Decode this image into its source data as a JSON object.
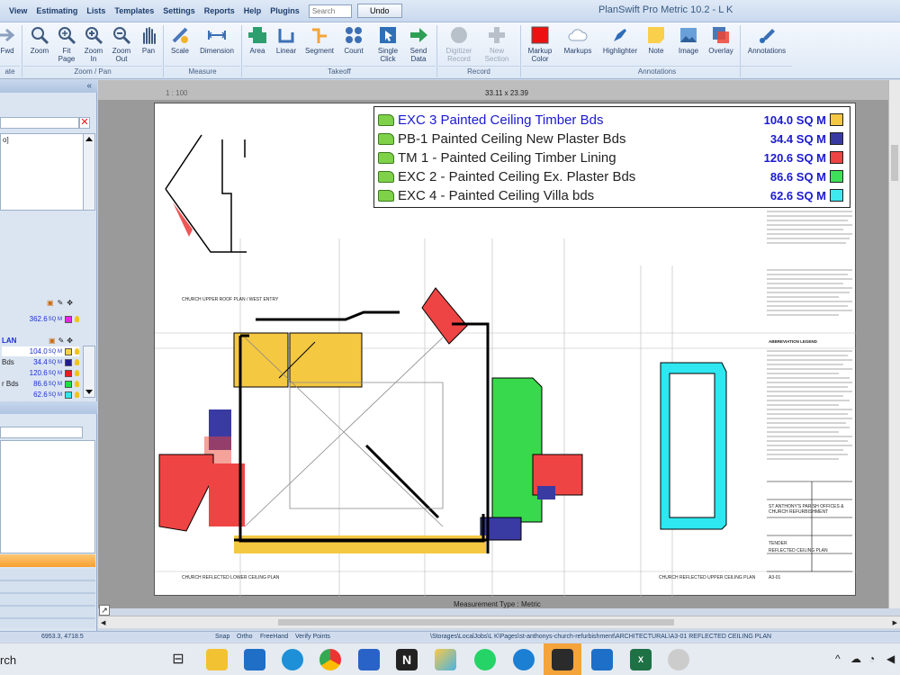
{
  "app": {
    "title": "PlanSwift Pro Metric 10.2 - L K"
  },
  "menu": [
    "View",
    "Estimating",
    "Lists",
    "Templates",
    "Settings",
    "Reports",
    "Help",
    "Plugins"
  ],
  "search_placeholder": "Search",
  "undo_label": "Undo",
  "ribbon": {
    "buttons": {
      "fwd": "Fwd",
      "zoom": "Zoom",
      "fit_page": "Fit Page",
      "zoom_in": "Zoom In",
      "zoom_out": "Zoom Out",
      "pan": "Pan",
      "scale": "Scale",
      "dimension": "Dimension",
      "area": "Area",
      "linear": "Linear",
      "segment": "Segment",
      "count": "Count",
      "single_click": "Single Click",
      "send_data": "Send Data",
      "digitizer_record": "Digitizer Record",
      "new_section": "New Section",
      "markup_color": "Markup Color",
      "markups": "Markups",
      "highlighter": "Highlighter",
      "note": "Note",
      "image": "Image",
      "overlay": "Overlay",
      "annotations": "Annotations"
    },
    "groups": {
      "ate": "ate",
      "zoom_pan": "Zoom / Pan",
      "measure": "Measure",
      "takeoff": "Takeoff",
      "record": "Record",
      "annotations": "Annotations"
    }
  },
  "left_panel": {
    "collapse": "«",
    "tree_top": "o]",
    "total1_val": "362.6",
    "unit": "SQ M",
    "section_title": "LAN",
    "items": [
      {
        "label": "",
        "val": "104.0",
        "color": "#fbd04a"
      },
      {
        "label": "Bds",
        "val": "34.4",
        "color": "#1d1d8f"
      },
      {
        "label": "",
        "val": "120.6",
        "color": "#e81c1c"
      },
      {
        "label": "r Bds",
        "val": "86.6",
        "color": "#22e03c"
      },
      {
        "label": "",
        "val": "62.6",
        "color": "#2ee7f0"
      }
    ]
  },
  "sheet": {
    "scale": "1 : 100",
    "size": "33.11 x 23.39",
    "measurement_type": "Measurement Type : Metric"
  },
  "legend": [
    {
      "label": "EXC 3 Painted Ceiling Timber Bds",
      "value": "104.0 SQ M",
      "color": "#f4c842",
      "highlight": true
    },
    {
      "label": "PB-1 Painted Ceiling New Plaster Bds",
      "value": "34.4 SQ M",
      "color": "#3a3aa3",
      "highlight": false
    },
    {
      "label": "TM 1 - Painted Ceiling Timber Lining",
      "value": "120.6 SQ M",
      "color": "#ef4444",
      "highlight": false
    },
    {
      "label": "EXC 2 - Painted Ceiling Ex. Plaster Bds",
      "value": "86.6 SQ M",
      "color": "#3ee05a",
      "highlight": false
    },
    {
      "label": "EXC 4 - Painted Ceiling Villa bds",
      "value": "62.6 SQ M",
      "color": "#3eeaf0",
      "highlight": false
    }
  ],
  "drawing_text": {
    "upper_plan": "CHURCH UPPER ROOF PLAN / WEST ENTRY",
    "lower_plan": "CHURCH REFLECTED LOWER CEILING PLAN",
    "right_plan": "CHURCH REFLECTED UPPER CEILING PLAN",
    "project": "ST ANTHONY'S PARISH OFFICES & CHURCH REFURBISHMENT",
    "sheet_title": "REFLECTED CEILING PLAN",
    "tender": "TENDER",
    "sheet_no": "A3-01",
    "abbrev": "ABBREVIATION LEGEND"
  },
  "status": {
    "coords": "6953.3, 4718.5",
    "snap": "Snap",
    "ortho": "Ortho",
    "freehand": "FreeHand",
    "verify": "Verify Points",
    "path": "\\Storages\\LocalJobs\\L K\\Pages\\st-anthonys-church-refurbishment\\ARCHITECTURAL\\A3-01 REFLECTED CEILING PLAN"
  },
  "taskbar": {
    "search_text": "rch"
  },
  "colors": {
    "ribbon_text": "#28406a",
    "legend_value": "#1a1ad0",
    "accent_orange": "#f7a030"
  }
}
